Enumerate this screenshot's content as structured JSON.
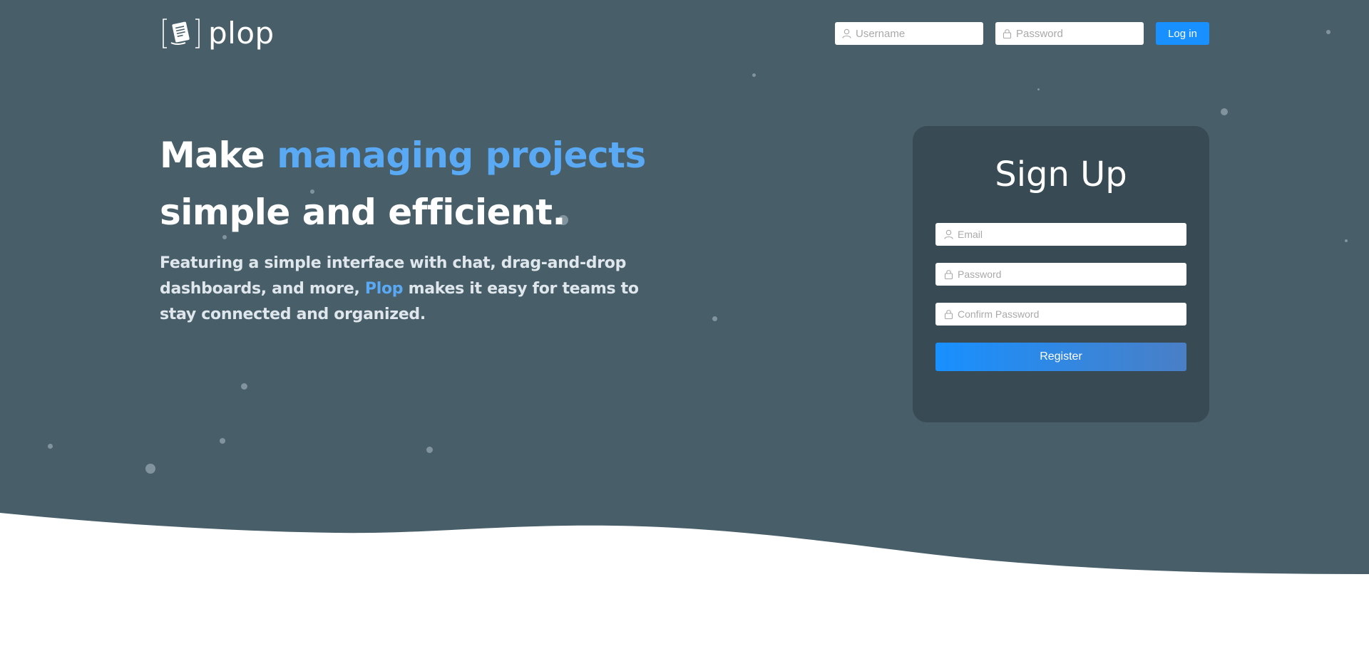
{
  "brand": {
    "name": "plop",
    "logo_icon": "document-in-brackets-icon"
  },
  "header": {
    "username_placeholder": "Username",
    "password_placeholder": "Password",
    "login_label": "Log in",
    "user_icon": "user-icon",
    "lock_icon": "lock-icon"
  },
  "hero": {
    "headline_part1": "Make ",
    "headline_accent": "managing projects",
    "headline_part2": "simple and efficient.",
    "sub_part1": "Featuring a simple interface with chat, drag-and-drop dashboards, and more, ",
    "sub_accent": "Plop",
    "sub_part2": " makes it easy for teams to stay connected and organized."
  },
  "signup": {
    "title": "Sign Up",
    "email_placeholder": "Email",
    "password_placeholder": "Password",
    "confirm_placeholder": "Confirm Password",
    "register_label": "Register"
  },
  "colors": {
    "hero_background": "#485f6a",
    "card_background": "#384a53",
    "accent": "#5aa9f5",
    "primary_button": "#1890ff"
  }
}
